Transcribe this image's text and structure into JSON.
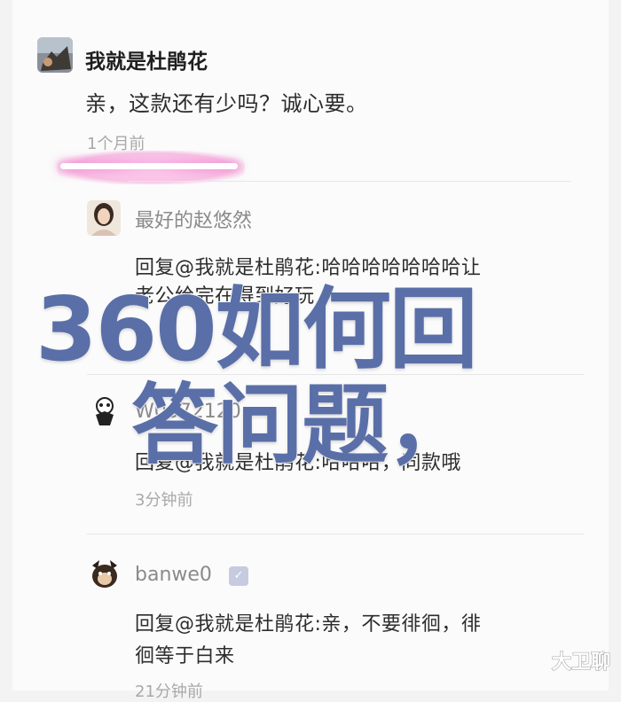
{
  "main_post": {
    "username": "我就是杜鹃花",
    "text": "亲，这款还有少吗？诚心要。",
    "time": "1个月前"
  },
  "replies": [
    {
      "username": "最好的赵悠然",
      "text_line1": "回复@我就是杜鹃花:哈哈哈哈哈哈哈让",
      "text_line2": "老公给完在得到好玩"
    },
    {
      "username": "W0072120",
      "text_line1": "回复@我就是杜鹃花:哈哈哈，同款哦",
      "time": "3分钟前"
    },
    {
      "username": "banwe0",
      "text_line1": "回复@我就是杜鹃花:亲，不要徘徊，徘",
      "text_line2": "徊等于白来",
      "time": "21分钟前"
    }
  ],
  "overlay": {
    "line1": "360如何回",
    "line2": "答问题，"
  },
  "watermark": "大卫聊",
  "colors": {
    "overlay": "#5a6fa8",
    "highlight_glow": "#ee8fd0"
  },
  "icons": {
    "verified": "verified-badge-icon"
  }
}
